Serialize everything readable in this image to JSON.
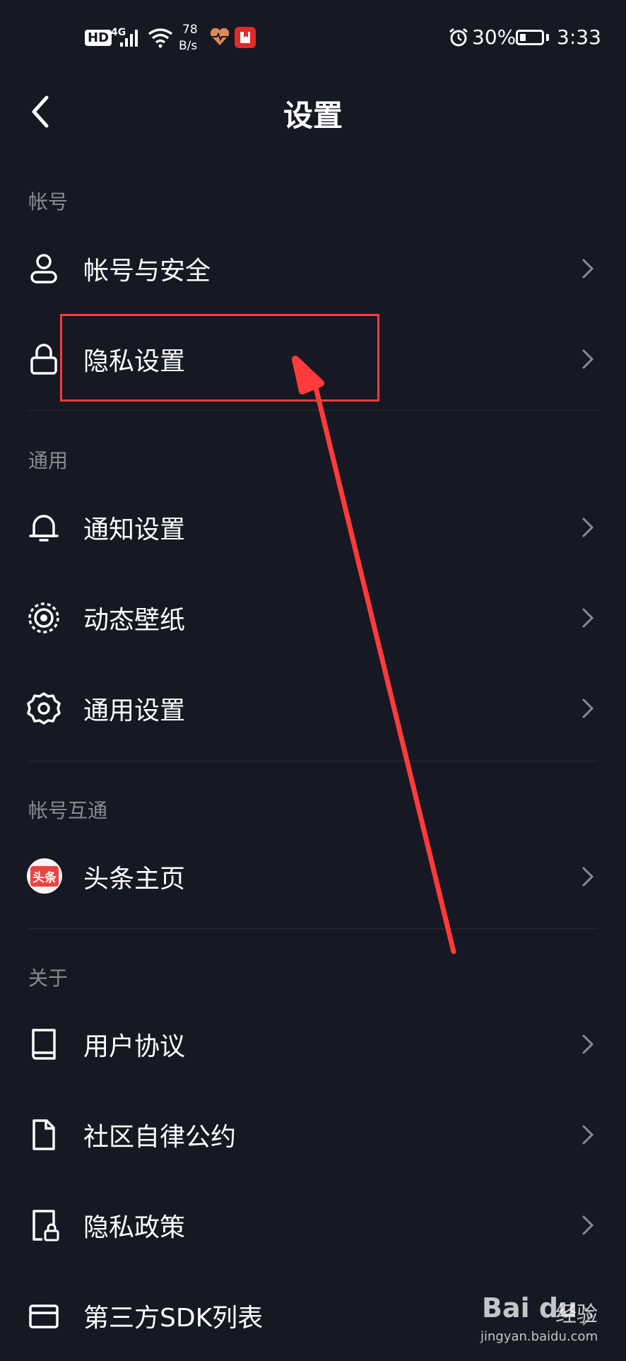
{
  "status_bar": {
    "hd": "HD",
    "network": "4G",
    "speed_value": "78",
    "speed_unit": "B/s",
    "battery_pct": "30%",
    "battery_level": 0.3,
    "time": "3:33"
  },
  "header": {
    "title": "设置"
  },
  "sections": {
    "account": {
      "title": "帐号",
      "items": [
        {
          "label": "帐号与安全",
          "icon": "user-icon"
        },
        {
          "label": "隐私设置",
          "icon": "lock-icon"
        }
      ]
    },
    "general": {
      "title": "通用",
      "items": [
        {
          "label": "通知设置",
          "icon": "bell-icon"
        },
        {
          "label": "动态壁纸",
          "icon": "wallpaper-icon"
        },
        {
          "label": "通用设置",
          "icon": "gear-icon"
        }
      ]
    },
    "interop": {
      "title": "帐号互通",
      "items": [
        {
          "label": "头条主页",
          "icon": "toutiao-icon",
          "badge": "头条"
        }
      ]
    },
    "about": {
      "title": "关于",
      "items": [
        {
          "label": "用户协议",
          "icon": "book-icon"
        },
        {
          "label": "社区自律公约",
          "icon": "document-icon"
        },
        {
          "label": "隐私政策",
          "icon": "privacy-file-icon"
        },
        {
          "label": "第三方SDK列表",
          "icon": "wallet-icon"
        }
      ]
    }
  },
  "watermark": {
    "logo": "Bai du",
    "cn": "经验",
    "url": "jingyan.baidu.com"
  },
  "colors": {
    "background": "#161823",
    "annotation": "#ff3b3b",
    "section_title": "#8a8b91"
  }
}
